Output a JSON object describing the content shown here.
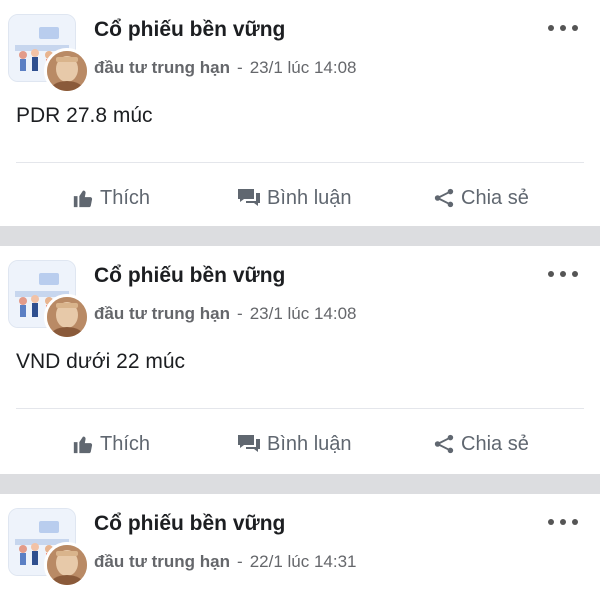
{
  "posts": [
    {
      "group_name": "Cổ phiếu bền vững",
      "author": "đầu tư trung hạn",
      "separator": "-",
      "timestamp": "23/1 lúc 14:08",
      "body": "PDR 27.8 múc",
      "actions": {
        "like": "Thích",
        "comment": "Bình luận",
        "share": "Chia sẻ"
      }
    },
    {
      "group_name": "Cổ phiếu bền vững",
      "author": "đầu tư trung hạn",
      "separator": "-",
      "timestamp": "23/1 lúc 14:08",
      "body": "VND dưới 22 múc",
      "actions": {
        "like": "Thích",
        "comment": "Bình luận",
        "share": "Chia sẻ"
      }
    },
    {
      "group_name": "Cổ phiếu bền vững",
      "author": "đầu tư trung hạn",
      "separator": "-",
      "timestamp": "22/1 lúc 14:31"
    }
  ],
  "icons": {
    "like": "thumbs-up-icon",
    "comment": "comment-icon",
    "share": "share-icon",
    "more": "more-options-icon"
  },
  "colors": {
    "background": "#dcdde0",
    "card": "#ffffff",
    "text": "#1c1e21",
    "muted": "#65676b",
    "action": "#606770"
  }
}
